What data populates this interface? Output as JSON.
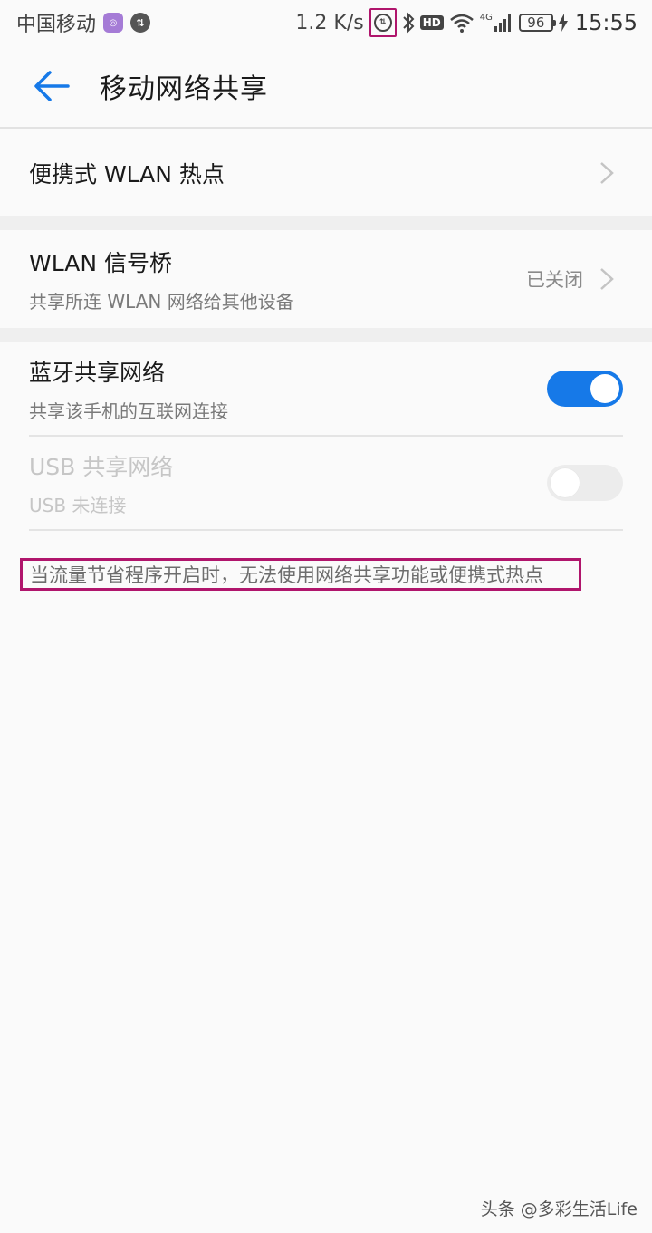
{
  "status_bar": {
    "carrier": "中国移动",
    "speed": "1.2 K/s",
    "network": "4G",
    "hd": "HD",
    "battery": "96",
    "time": "15:55"
  },
  "header": {
    "title": "移动网络共享"
  },
  "items": {
    "hotspot": {
      "title": "便携式 WLAN 热点"
    },
    "bridge": {
      "title": "WLAN 信号桥",
      "subtitle": "共享所连 WLAN 网络给其他设备",
      "value": "已关闭"
    },
    "bluetooth": {
      "title": "蓝牙共享网络",
      "subtitle": "共享该手机的互联网连接",
      "enabled": true
    },
    "usb": {
      "title": "USB 共享网络",
      "subtitle": "USB 未连接",
      "enabled": false
    }
  },
  "note": "当流量节省程序开启时，无法使用网络共享功能或便携式热点",
  "watermark": "头条 @多彩生活Life",
  "colors": {
    "accent": "#1679e8",
    "highlight": "#b0156c"
  }
}
